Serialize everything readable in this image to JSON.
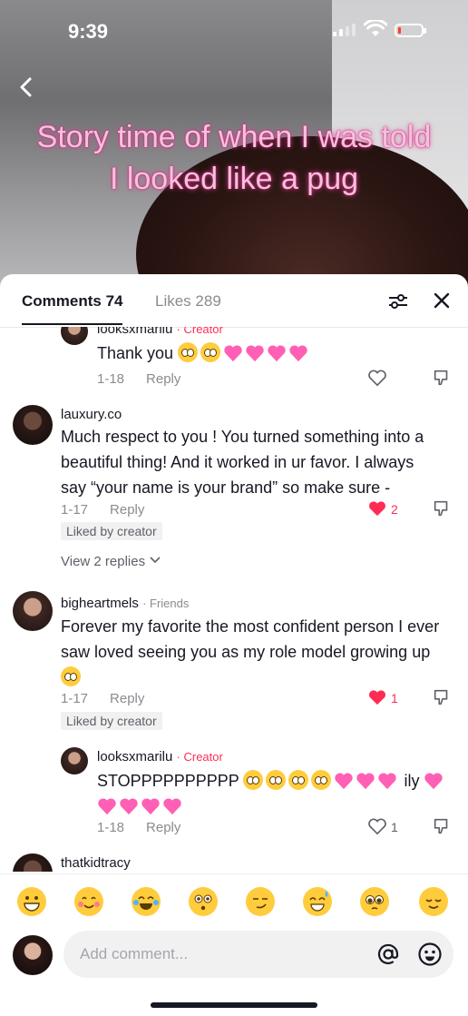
{
  "status_bar": {
    "time": "9:39"
  },
  "video": {
    "caption_line1": "Story time of when I was told",
    "caption_line2": "I looked like a pug"
  },
  "tabs": {
    "comments": "Comments 74",
    "likes": "Likes 289"
  },
  "comments": [
    {
      "user": "looksxmarilu",
      "tag": "· Creator",
      "text_prefix": "Thank you",
      "date": "1-18",
      "reply": "Reply"
    },
    {
      "user": "lauxury.co",
      "text": "Much respect to you ! You turned something into a beautiful thing! And it worked in ur favor. I always say “your name is your brand” so make sure -",
      "date": "1-17",
      "reply": "Reply",
      "likes": "2",
      "liked_by": "Liked by creator",
      "view_replies": "View 2 replies"
    },
    {
      "user": "bigheartmels",
      "tag": "· Friends",
      "text": "Forever my favorite the most confident person I ever saw loved seeing you as my role model growing up",
      "date": "1-17",
      "reply": "Reply",
      "likes": "1",
      "liked_by": "Liked by creator"
    },
    {
      "user": "looksxmarilu",
      "tag": "· Creator",
      "text_prefix": "STOPPPPPPPPPP",
      "text_suffix": "ily",
      "date": "1-18",
      "reply": "Reply",
      "likes": "1"
    },
    {
      "user": "thatkidtracy"
    }
  ],
  "emoji_bar": [
    "grin",
    "smiling-hearts",
    "tears-of-joy",
    "flushed",
    "smirk",
    "sweat-smile",
    "pleading",
    "relieved"
  ],
  "composer": {
    "placeholder": "Add comment..."
  },
  "colors": {
    "accent": "#fe2c55",
    "heart": "#fe2c55",
    "caption_pink": "#f7c0de"
  }
}
